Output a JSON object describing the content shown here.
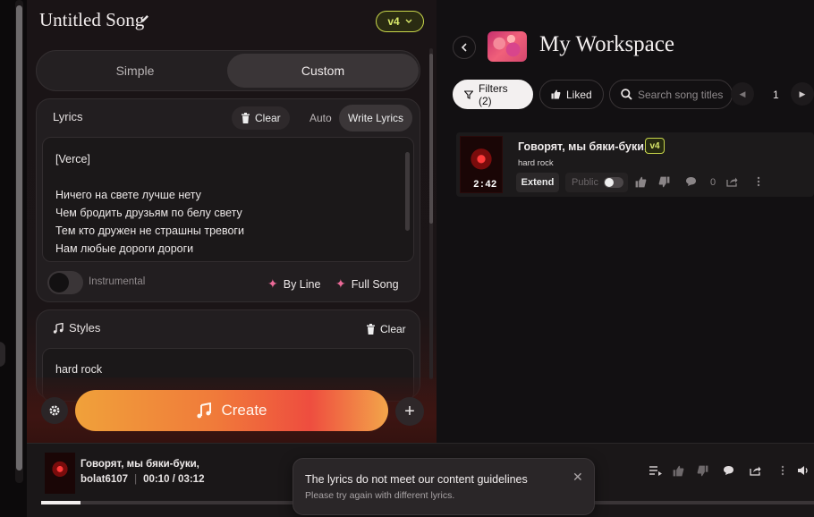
{
  "song": {
    "title": "Untitled Song",
    "version": "v4"
  },
  "mode": {
    "simple": "Simple",
    "custom": "Custom",
    "selected": "Custom"
  },
  "lyrics": {
    "label": "Lyrics",
    "clear": "Clear",
    "auto": "Auto",
    "write": "Write Lyrics",
    "text": "[Verce]\n\nНичего на свете лучше нету\nЧем бродить друзьям по белу свету\nТем кто дружен не страшны тревоги\nНам любые дороги дороги"
  },
  "instrumental": {
    "label": "Instrumental",
    "on": false
  },
  "generate": {
    "by_line": "By Line",
    "full_song": "Full Song"
  },
  "styles": {
    "label": "Styles",
    "clear": "Clear",
    "value": "hard rock"
  },
  "create": {
    "label": "Create"
  },
  "workspace": {
    "title": "My Workspace",
    "filters": "Filters (2)",
    "liked": "Liked",
    "search_placeholder": "Search song titles",
    "page": "1"
  },
  "songs": [
    {
      "title": "Говорят, мы бяки-буки,",
      "version": "v4",
      "style": "hard rock",
      "duration": "2:42",
      "extend": "Extend",
      "public": "Public",
      "comments": "0"
    }
  ],
  "player": {
    "title": "Говорят, мы бяки-буки,",
    "artist": "bolat6107",
    "sep": "|",
    "time": "00:10 / 03:12",
    "progress": 0.05
  },
  "toast": {
    "title": "The lyrics do not meet our content guidelines",
    "message": "Please try again with different lyrics.",
    "close": "✕"
  },
  "colors": {
    "accent_version": "#c8d64a",
    "create_gradient_start": "#f0a13a",
    "create_gradient_end": "#ee4d3f",
    "spark": "#ec6a98"
  }
}
